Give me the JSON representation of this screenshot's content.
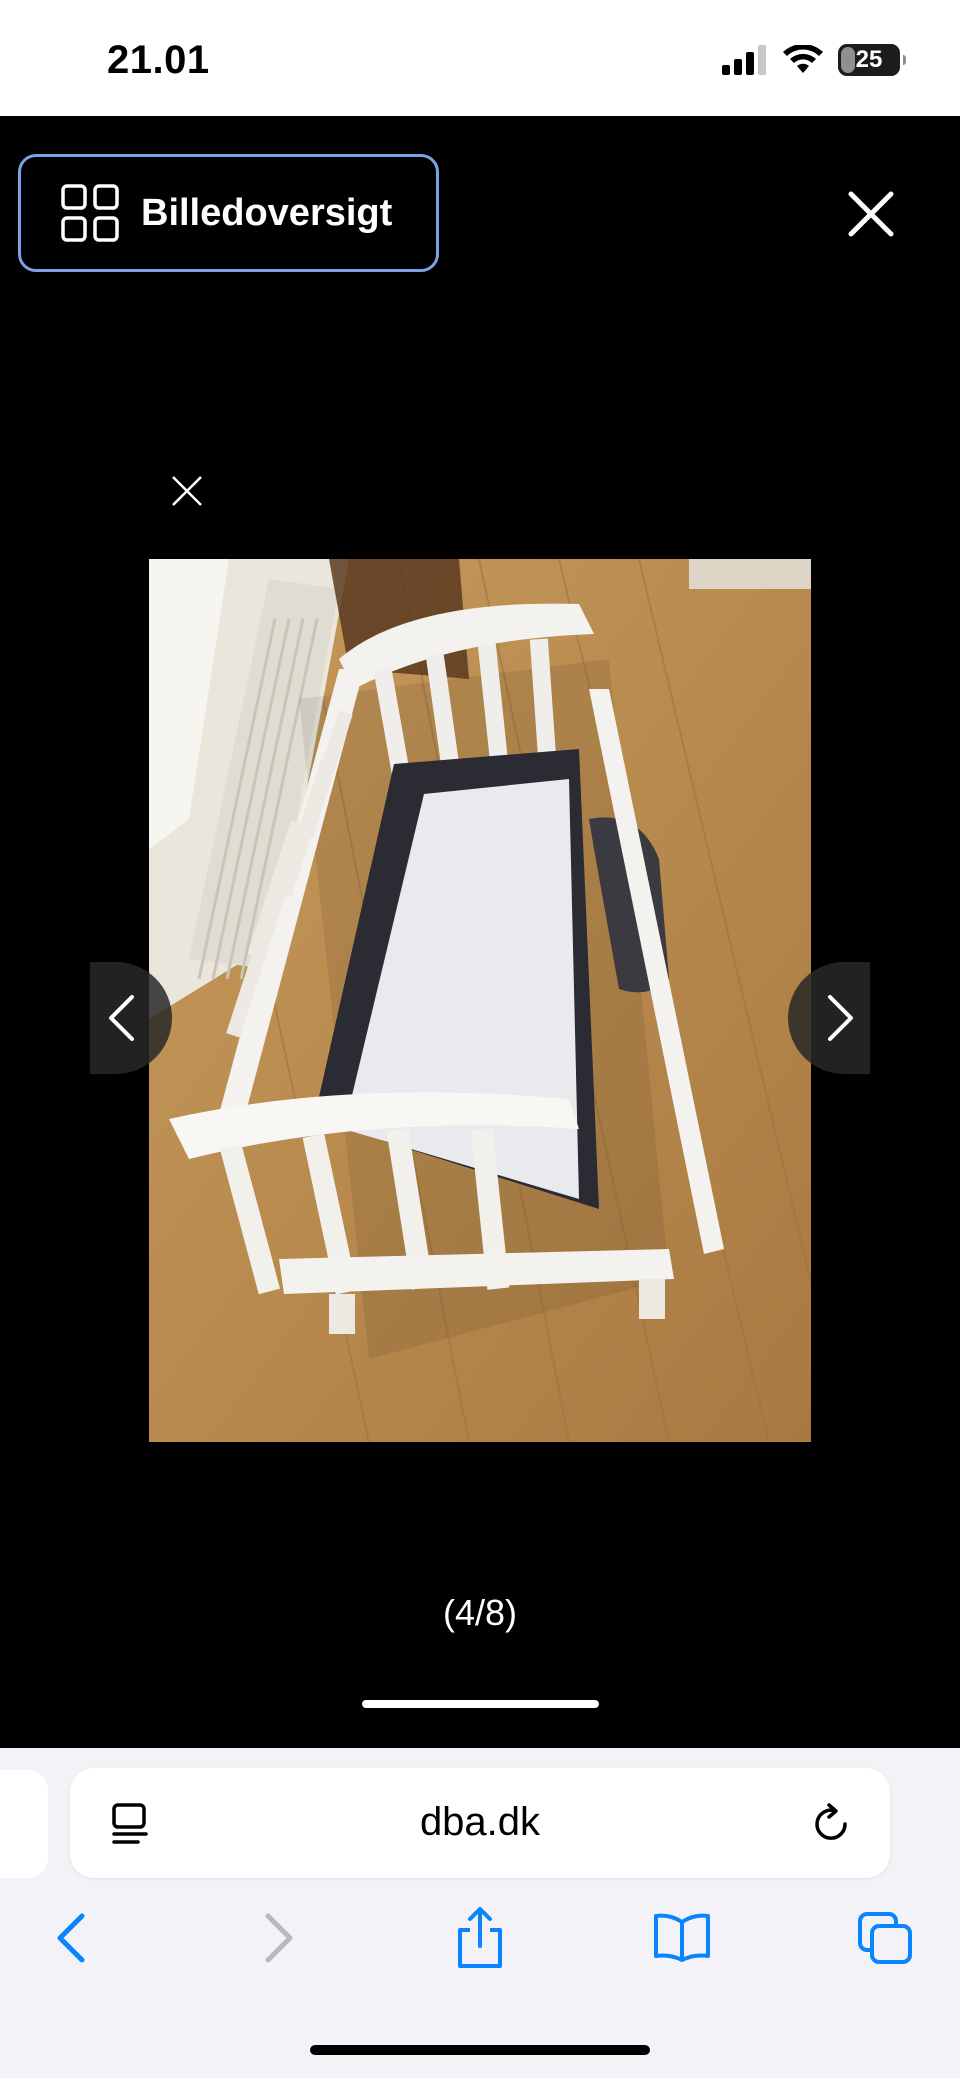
{
  "status_bar": {
    "time": "21.01",
    "battery_level": "25",
    "battery_fraction": 0.25,
    "signal_bars": 3,
    "icons": [
      "signal-icon",
      "wifi-icon",
      "battery-icon"
    ]
  },
  "viewer": {
    "gallery_button_label": "Billedoversigt",
    "gallery_icon": "grid-icon",
    "close_icon": "close-icon",
    "image_description_icon": "small-close-icon",
    "counter": "(4/8)",
    "prev_icon": "chevron-left-icon",
    "next_icon": "chevron-right-icon"
  },
  "browser": {
    "url": "dba.dk",
    "reader_icon": "reader-icon",
    "reload_icon": "reload-icon",
    "toolbar": [
      "back-icon",
      "forward-icon",
      "share-icon",
      "bookmarks-icon",
      "tabs-icon"
    ]
  },
  "colors": {
    "accent": "#0a84ff",
    "gallery_border": "#7aa3e6",
    "background": "#000000"
  }
}
